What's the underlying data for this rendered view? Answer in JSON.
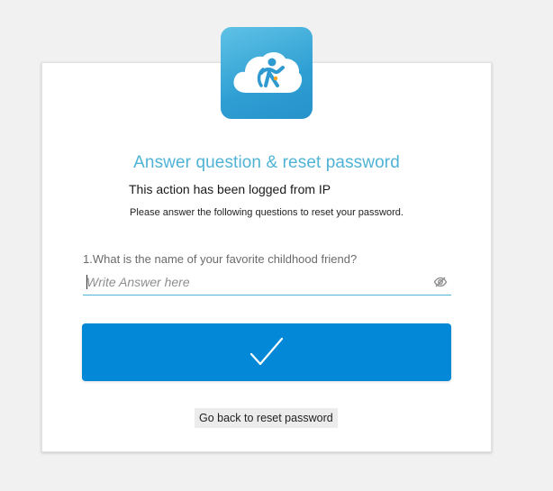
{
  "colors": {
    "page_background": "#f1f1f1",
    "title": "#4fb3d6",
    "submit_button": "#0288d6",
    "logo_gradient_light": "#5fc2e6",
    "logo_gradient_dark": "#2692c9"
  },
  "logo": {
    "icon": "cloud-person-logo-icon"
  },
  "header": {
    "title": "Answer question & reset password",
    "logged_notice": "This action has been logged from IP",
    "instructions": "Please answer the following questions to reset your password."
  },
  "form": {
    "question": "1.What is the name of your favorite childhood friend?",
    "answer_value": "",
    "answer_placeholder": "Write Answer here",
    "visibility_toggle_icon": "eye-off-icon",
    "submit_icon": "checkmark-icon"
  },
  "footer": {
    "back_label": "Go back to reset password"
  }
}
